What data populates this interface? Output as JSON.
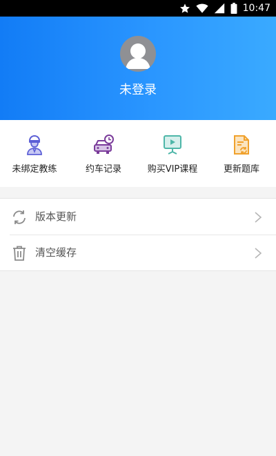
{
  "status_bar": {
    "time": "10:47",
    "icons": [
      "star-icon",
      "wifi-icon",
      "signal-icon",
      "battery-icon"
    ]
  },
  "header": {
    "login_label": "未登录",
    "avatar": "default-avatar-icon"
  },
  "shortcuts": [
    {
      "label": "未绑定教练",
      "icon": "coach-icon",
      "color": "#5c5fd6"
    },
    {
      "label": "约车记录",
      "icon": "car-clock-icon",
      "color": "#7a3b9a"
    },
    {
      "label": "购买VIP课程",
      "icon": "video-lesson-icon",
      "color": "#4db6a8"
    },
    {
      "label": "更新题库",
      "icon": "document-refresh-icon",
      "color": "#f0a12c"
    }
  ],
  "menu": [
    {
      "label": "版本更新",
      "icon": "refresh-icon"
    },
    {
      "label": "清空缓存",
      "icon": "trash-icon"
    }
  ],
  "colors": {
    "header_start": "#127cf6",
    "header_end": "#3aaaff",
    "background": "#f4f4f4"
  }
}
